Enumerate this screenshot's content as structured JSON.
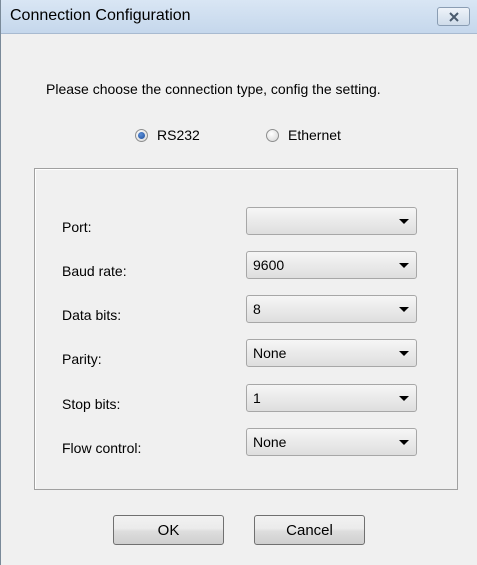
{
  "window": {
    "title": "Connection Configuration"
  },
  "prompt": "Please choose the connection type, config the setting.",
  "connection_type": {
    "options": [
      {
        "label": "RS232",
        "selected": true
      },
      {
        "label": "Ethernet",
        "selected": false
      }
    ]
  },
  "fields": [
    {
      "label": "Port:",
      "value": ""
    },
    {
      "label": "Baud rate:",
      "value": "9600"
    },
    {
      "label": "Data bits:",
      "value": "8"
    },
    {
      "label": "Parity:",
      "value": "None"
    },
    {
      "label": "Stop bits:",
      "value": "1"
    },
    {
      "label": "Flow control:",
      "value": "None"
    }
  ],
  "buttons": {
    "ok_label": "OK",
    "cancel_label": "Cancel"
  }
}
